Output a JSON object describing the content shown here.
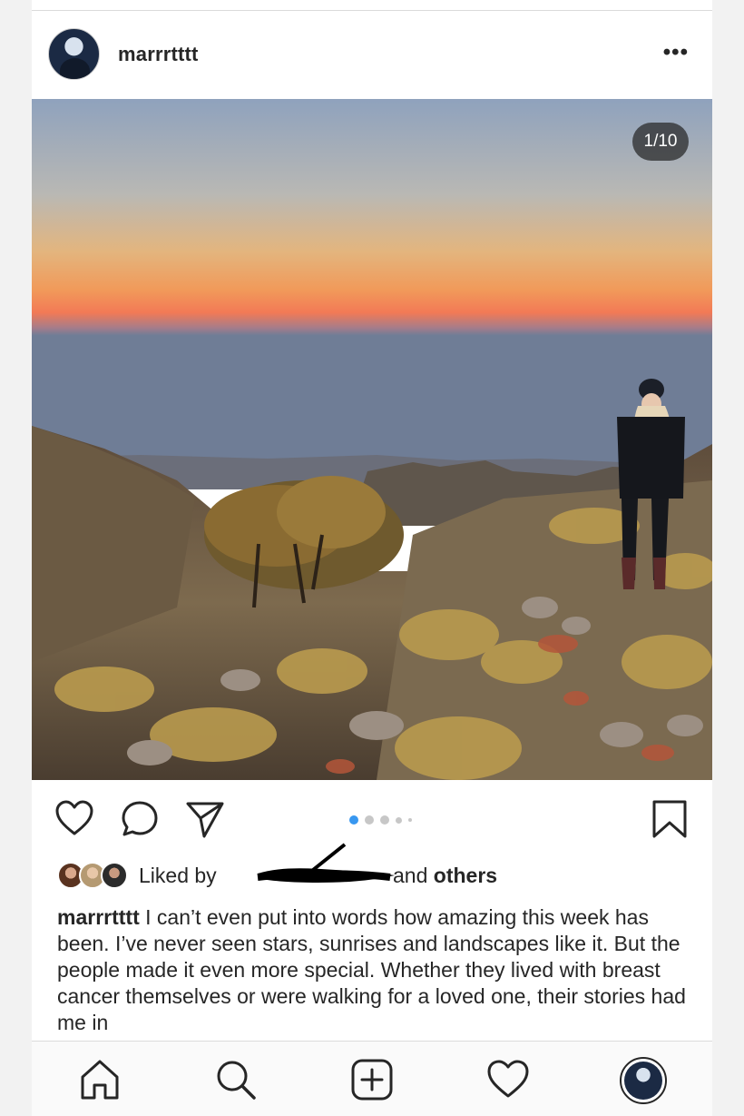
{
  "post": {
    "username": "marrrtttt",
    "more_label": "•••",
    "counter": "1/10"
  },
  "carousel": {
    "total_visible_dots": 5,
    "active_index": 0
  },
  "likes": {
    "liked_by_prefix": "Liked by",
    "and_label": "and",
    "others_label": "others"
  },
  "caption": {
    "username": "marrrtttt",
    "text": "I can’t even put into words how amazing this week has been. I’ve never seen stars, sunrises and landscapes like it. But the people made it even more special. Whether they lived with breast cancer themselves or were walking for a loved one, their stories had me in"
  },
  "icons": {
    "like": "heart-icon",
    "comment": "comment-icon",
    "share": "send-icon",
    "save": "bookmark-icon",
    "home": "home-icon",
    "search": "search-icon",
    "new_post": "plus-square-icon",
    "activity": "heart-icon",
    "profile": "profile-avatar"
  },
  "colors": {
    "accent_dot": "#3897f0",
    "text": "#262626"
  }
}
